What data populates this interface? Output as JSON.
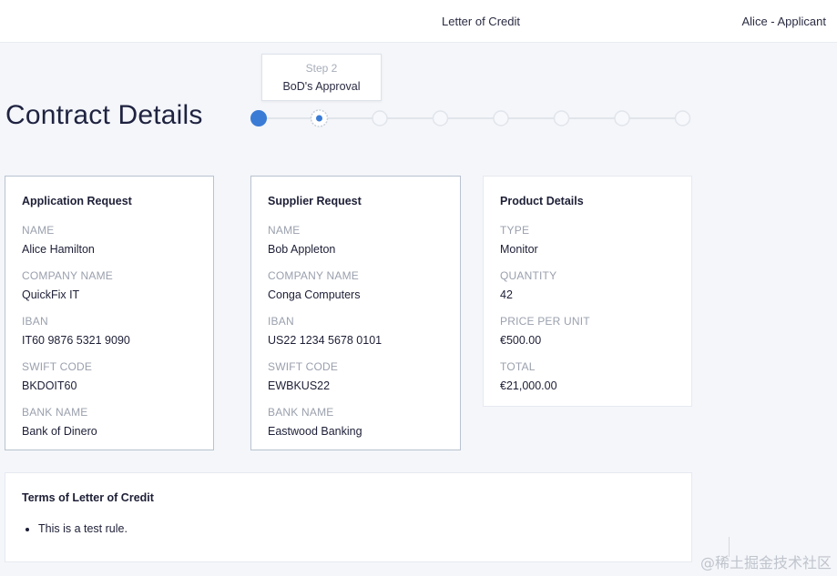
{
  "header": {
    "title": "Letter of Credit",
    "user": "Alice - Applicant"
  },
  "page": {
    "title": "Contract Details"
  },
  "stepper": {
    "tooltip_step": "Step 2",
    "tooltip_name": "BoD's Approval",
    "current_step": 2,
    "total_steps": 8,
    "colors": {
      "done": "#3a7bd5",
      "pending": "#e1e5eb"
    }
  },
  "cards": {
    "application": {
      "title": "Application Request",
      "fields": [
        {
          "label": "NAME",
          "value": "Alice Hamilton"
        },
        {
          "label": "COMPANY NAME",
          "value": "QuickFix IT"
        },
        {
          "label": "IBAN",
          "value": "IT60 9876 5321 9090"
        },
        {
          "label": "SWIFT CODE",
          "value": "BKDOIT60"
        },
        {
          "label": "BANK NAME",
          "value": "Bank of Dinero"
        }
      ]
    },
    "supplier": {
      "title": "Supplier Request",
      "fields": [
        {
          "label": "NAME",
          "value": "Bob Appleton"
        },
        {
          "label": "COMPANY NAME",
          "value": "Conga Computers"
        },
        {
          "label": "IBAN",
          "value": "US22 1234 5678 0101"
        },
        {
          "label": "SWIFT CODE",
          "value": "EWBKUS22"
        },
        {
          "label": "BANK NAME",
          "value": "Eastwood Banking"
        }
      ]
    },
    "product": {
      "title": "Product Details",
      "fields": [
        {
          "label": "TYPE",
          "value": "Monitor"
        },
        {
          "label": "QUANTITY",
          "value": "42"
        },
        {
          "label": "PRICE PER UNIT",
          "value": "€500.00"
        },
        {
          "label": "TOTAL",
          "value": "€21,000.00"
        }
      ]
    }
  },
  "terms": {
    "title": "Terms of Letter of Credit",
    "rules": [
      "This is a test rule."
    ]
  },
  "watermark": "@稀土掘金技术社区"
}
